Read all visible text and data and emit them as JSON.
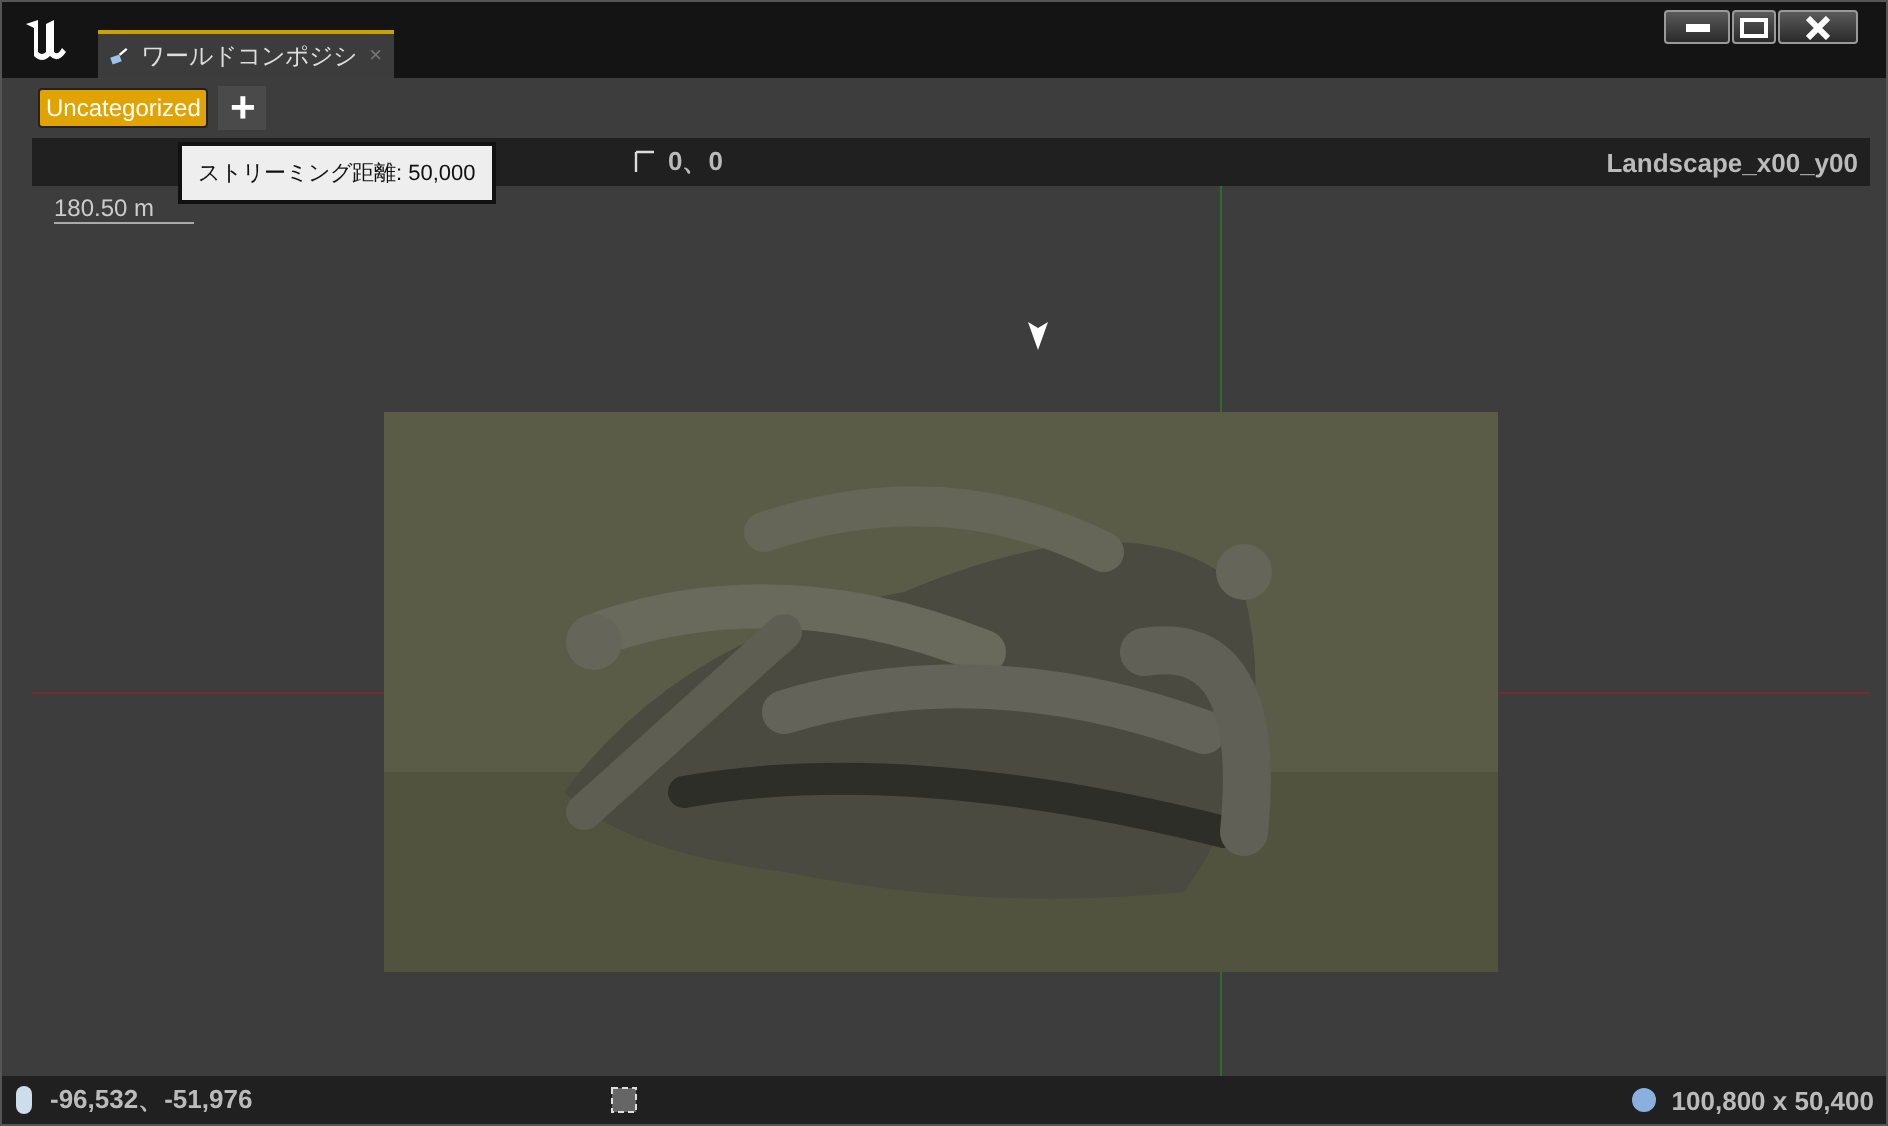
{
  "window": {
    "tab_title": "ワールドコンポジシ",
    "tab_close": "×"
  },
  "toolbar": {
    "layers": [
      {
        "label": "Uncategorized",
        "selected": true
      }
    ],
    "add_label": "+"
  },
  "tooltip": "ストリーミング距離: 50,000",
  "info_bar": {
    "origin": "0、0",
    "level_name": "Landscape_x00_y00"
  },
  "canvas": {
    "scale": "180.50 m"
  },
  "status_bar": {
    "cursor": "-96,532、-51,976",
    "world_size": "100,800 x 50,400"
  }
}
